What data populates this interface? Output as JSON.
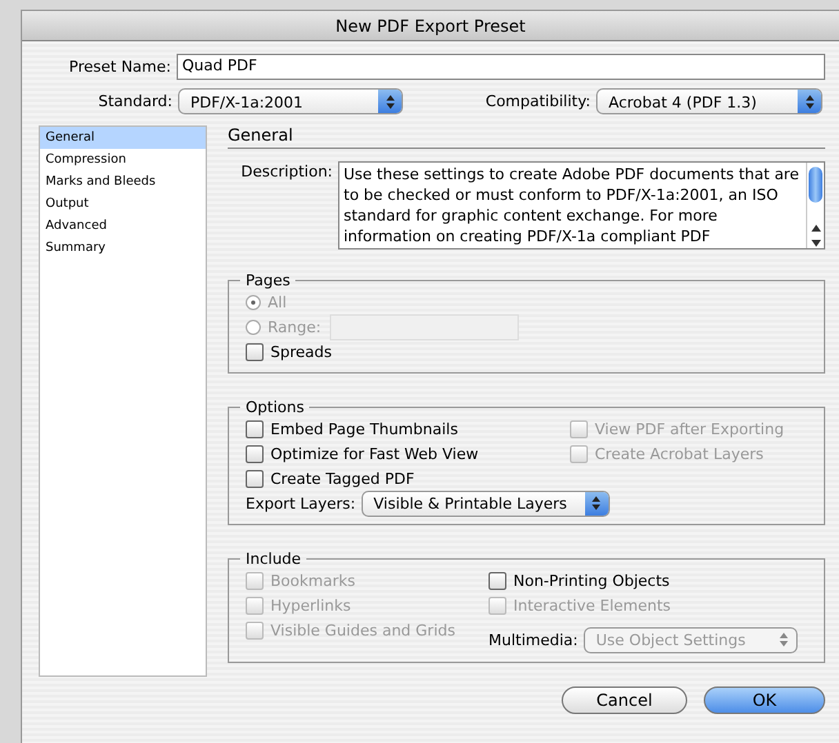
{
  "window": {
    "title": "New PDF Export Preset"
  },
  "preset_name": {
    "label": "Preset Name:",
    "value": "Quad PDF"
  },
  "standard": {
    "label": "Standard:",
    "value": "PDF/X-1a:2001"
  },
  "compatibility": {
    "label": "Compatibility:",
    "value": "Acrobat 4 (PDF 1.3)"
  },
  "sidebar": {
    "items": [
      {
        "label": "General",
        "selected": true
      },
      {
        "label": "Compression",
        "selected": false
      },
      {
        "label": "Marks and Bleeds",
        "selected": false
      },
      {
        "label": "Output",
        "selected": false
      },
      {
        "label": "Advanced",
        "selected": false
      },
      {
        "label": "Summary",
        "selected": false
      }
    ]
  },
  "section_title": "General",
  "description": {
    "label": "Description:",
    "lines": [
      "Use these settings to create Adobe PDF documents that are",
      "to be checked or must conform to PDF/X-1a:2001, an ISO",
      "standard for graphic content exchange.  For more",
      "information on creating PDF/X-1a compliant PDF"
    ]
  },
  "pages": {
    "title": "Pages",
    "radios": [
      {
        "label": "All",
        "selected": true,
        "disabled": true
      },
      {
        "label": "Range:",
        "selected": false,
        "disabled": true
      }
    ],
    "spreads": {
      "label": "Spreads",
      "checked": false,
      "disabled": false
    }
  },
  "options": {
    "title": "Options",
    "left": [
      {
        "label": "Embed Page Thumbnails",
        "checked": false,
        "disabled": false
      },
      {
        "label": "Optimize for Fast Web View",
        "checked": false,
        "disabled": false
      },
      {
        "label": "Create Tagged PDF",
        "checked": false,
        "disabled": false
      }
    ],
    "right": [
      {
        "label": "View PDF after Exporting",
        "checked": false,
        "disabled": true
      },
      {
        "label": "Create Acrobat Layers",
        "checked": false,
        "disabled": true
      }
    ],
    "export_layers": {
      "label": "Export Layers:",
      "value": "Visible & Printable Layers",
      "disabled": false
    }
  },
  "include": {
    "title": "Include",
    "left": [
      {
        "label": "Bookmarks",
        "checked": false,
        "disabled": true
      },
      {
        "label": "Hyperlinks",
        "checked": false,
        "disabled": true
      },
      {
        "label": "Visible Guides and Grids",
        "checked": false,
        "disabled": true
      }
    ],
    "right": [
      {
        "label": "Non-Printing Objects",
        "checked": false,
        "disabled": false
      },
      {
        "label": "Interactive Elements",
        "checked": false,
        "disabled": true
      }
    ],
    "multimedia": {
      "label": "Multimedia:",
      "value": "Use Object Settings",
      "disabled": true
    }
  },
  "buttons": [
    {
      "label": "Cancel",
      "default": false
    },
    {
      "label": "OK",
      "default": true
    }
  ]
}
